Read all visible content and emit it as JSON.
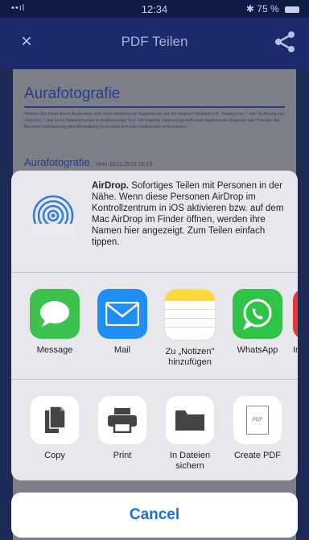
{
  "status_bar": {
    "signal": "••ıl",
    "time": "12:34",
    "battery": "75 %"
  },
  "navbar": {
    "close_glyph": "×",
    "title": "PDF Teilen"
  },
  "document": {
    "heading": "Aurafotografie",
    "paragraph": "Hinweis: Der Inhalt dieses Ausdruckes stellt keine medizinische Diagnose dar und die mögliche Wertwahl z.B. \"Heilung von...\" und \"Auflösung von Ursachen..\" sind keine Heilversprechen im medizinischen Sinn. Die folgende Optimierung stellt keine medizinische Diagnose oder Therapie dar! Bei einer Untersuchung oder Behandlung durch einen Arzt oder Heilpraktiker nicht ersetzen.",
    "subheading": "Aurafotografie",
    "date": "Vom 23.11.2018 16:19"
  },
  "airdrop": {
    "title": "AirDrop.",
    "description": "Sofortiges Teilen mit Personen in der Nähe. Wenn diese Personen AirDrop im Kontrollzentrum in iOS aktivieren bzw. auf dem Mac AirDrop im Finder öffnen, werden ihre Namen hier angezeigt. Zum Teilen einfach tippen."
  },
  "apps": [
    {
      "label": "Message",
      "icon": "message-icon",
      "color": "#3dc24f"
    },
    {
      "label": "Mail",
      "icon": "mail-icon",
      "color": "#1e8ef5"
    },
    {
      "label": "Zu „Notizen\" hinzufügen",
      "icon": "notes-icon",
      "color": "#ffd93b"
    },
    {
      "label": "WhatsApp",
      "icon": "whatsapp-icon",
      "color": "#2fc447"
    },
    {
      "label": "In",
      "icon": "partial-app-icon",
      "color": "#e53935"
    }
  ],
  "actions": [
    {
      "label": "Copy",
      "icon": "copy-icon"
    },
    {
      "label": "Print",
      "icon": "print-icon"
    },
    {
      "label": "In Dateien sichern",
      "icon": "folder-icon"
    },
    {
      "label": "Create PDF",
      "icon": "pdf-icon",
      "badge": "PDF"
    }
  ],
  "cancel_label": "Cancel"
}
